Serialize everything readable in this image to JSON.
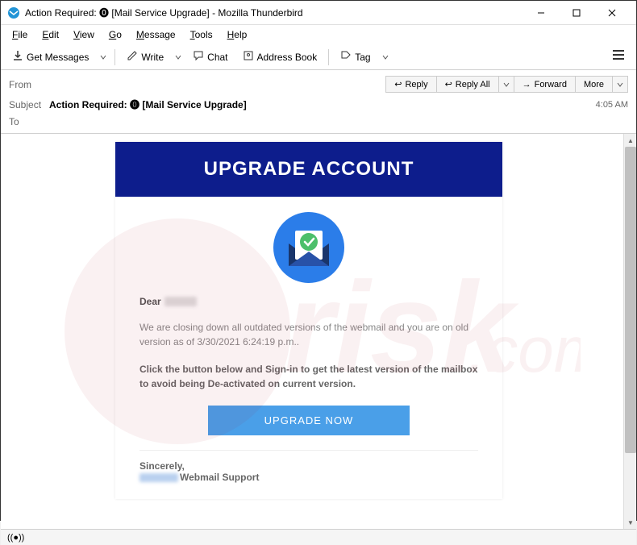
{
  "window": {
    "title": "Action Required: ⓿ [Mail Service Upgrade] - Mozilla Thunderbird"
  },
  "menu": {
    "file": "File",
    "edit": "Edit",
    "view": "View",
    "go": "Go",
    "message": "Message",
    "tools": "Tools",
    "help": "Help"
  },
  "toolbar": {
    "get_messages": "Get Messages",
    "write": "Write",
    "chat": "Chat",
    "address_book": "Address Book",
    "tag": "Tag"
  },
  "actions": {
    "reply": "Reply",
    "reply_all": "Reply All",
    "forward": "Forward",
    "more": "More"
  },
  "headers": {
    "from_label": "From",
    "from_value": "",
    "subject_label": "Subject",
    "subject_value": "Action Required: ⓿ [Mail Service Upgrade]",
    "to_label": "To",
    "to_value": "",
    "time": "4:05 AM"
  },
  "email": {
    "banner": "UPGRADE ACCOUNT",
    "greeting": "Dear",
    "para1": "We are closing down all outdated versions of the webmail and you are on old version as of 3/30/2021 6:24:19 p.m..",
    "para2": "Click the button below and Sign-in to get the latest version of the mailbox to avoid being De-activated on current version.",
    "button": "UPGRADE NOW",
    "sincerely": "Sincerely,",
    "support": "Webmail Support"
  },
  "colors": {
    "banner_bg": "#0d1d8c",
    "button_bg": "#4a9fe8"
  }
}
